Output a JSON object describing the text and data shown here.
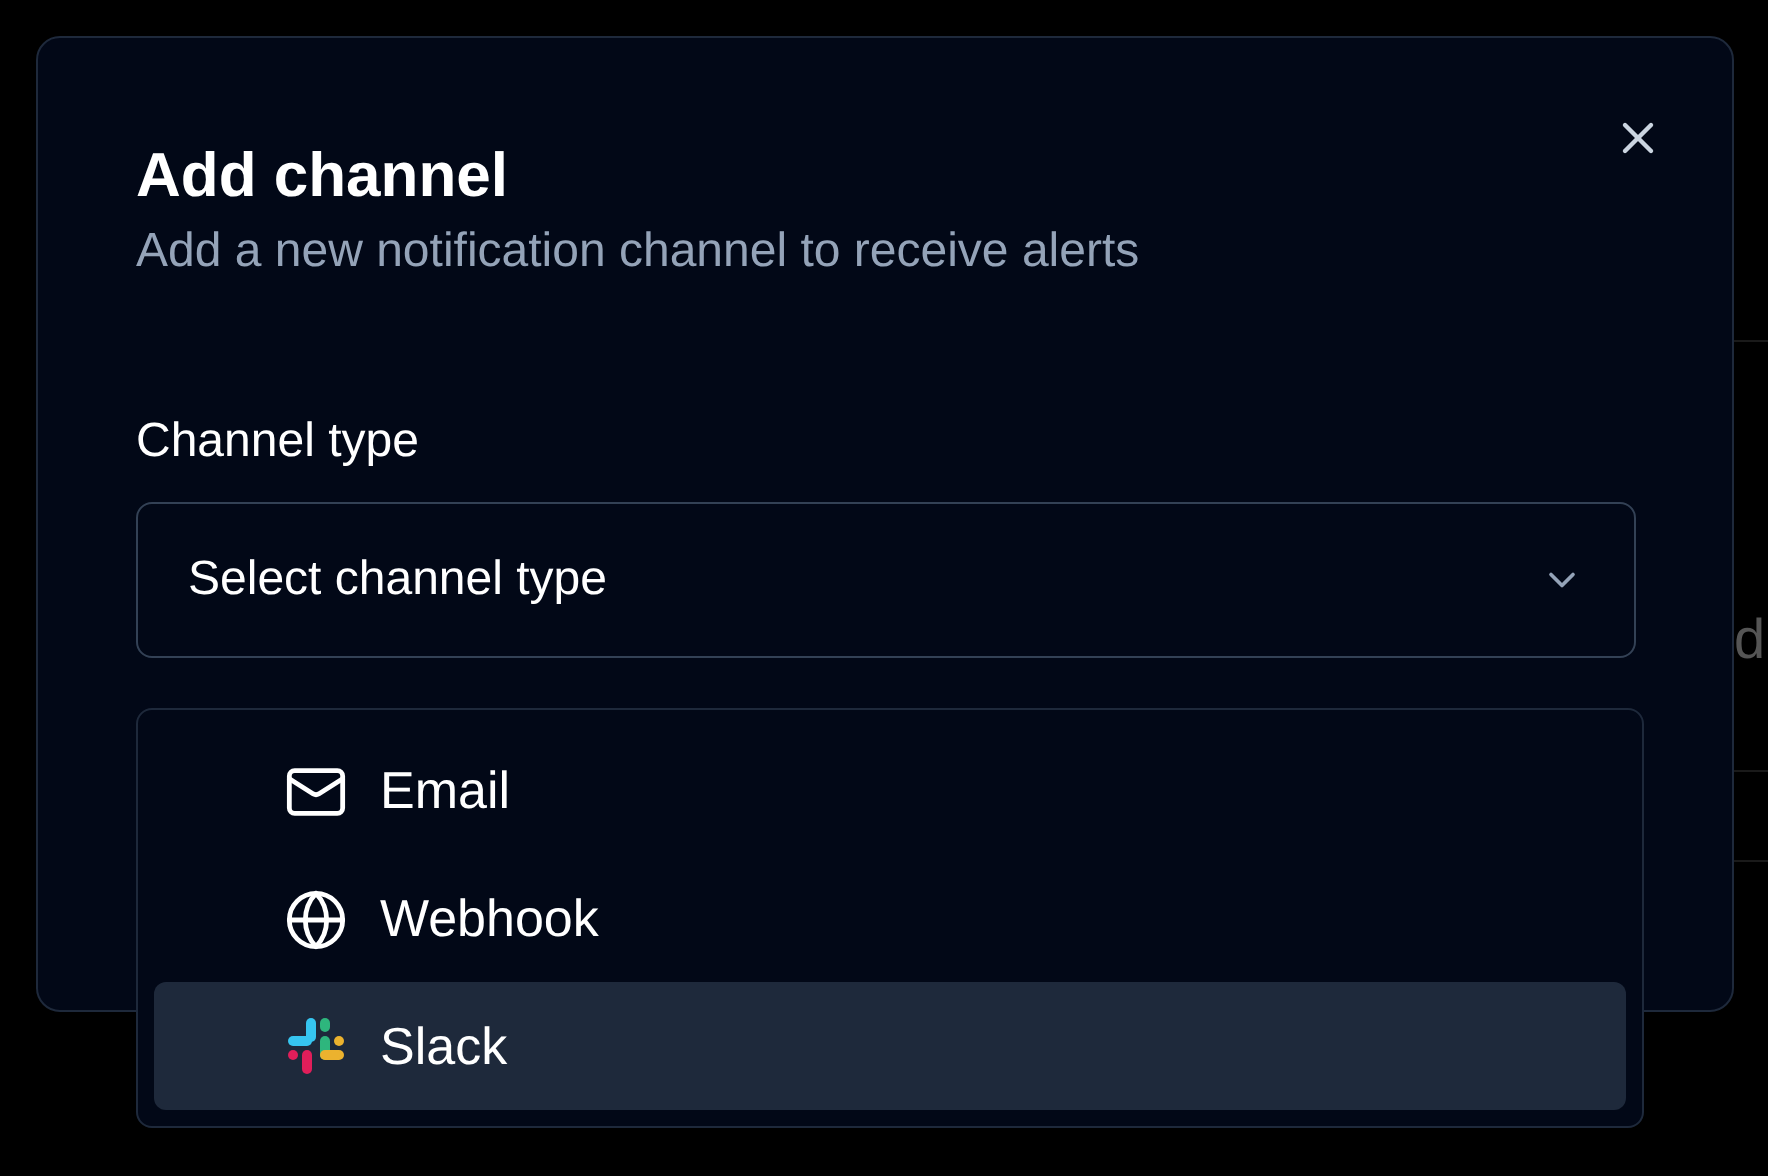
{
  "background": {
    "text_fragment": "d"
  },
  "dialog": {
    "title": "Add channel",
    "description": "Add a new notification channel to receive alerts",
    "field_label": "Channel type",
    "select": {
      "placeholder": "Select channel type",
      "expanded": true
    },
    "options": [
      {
        "kind": "email",
        "label": "Email",
        "selected": false
      },
      {
        "kind": "webhook",
        "label": "Webhook",
        "selected": false
      },
      {
        "kind": "slack",
        "label": "Slack",
        "selected": true
      }
    ]
  }
}
